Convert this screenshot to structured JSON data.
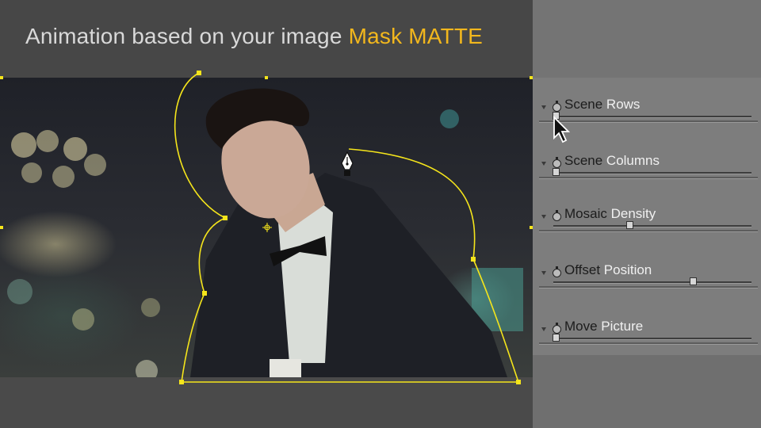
{
  "header": {
    "title_main": "Animation based on your image ",
    "title_accent": "Mask MATTE"
  },
  "colors": {
    "accent": "#f2b71d",
    "mask_path": "#f5e51b",
    "panel_bg": "#7d7d7d",
    "label_dark": "#1c1c1c",
    "label_light": "#f0f0f0"
  },
  "viewer": {
    "image_description_icon": "portrait-photo"
  },
  "params": [
    {
      "word1": "Scene",
      "word2": " Rows",
      "value": 0.0
    },
    {
      "word1": "Scene",
      "word2": " Columns",
      "value": 0.0
    },
    {
      "word1": "Mosaic",
      "word2": " Density",
      "value": 0.37
    },
    {
      "word1": "Offset",
      "word2": " Position",
      "value": 0.69
    },
    {
      "word1": "Move",
      "word2": " Picture",
      "value": 0.0
    }
  ],
  "icons": {
    "cursor": "arrow-cursor-icon",
    "pen": "pen-tool-icon",
    "stopwatch": "stopwatch-icon",
    "twirl": "triangle-down-icon"
  }
}
